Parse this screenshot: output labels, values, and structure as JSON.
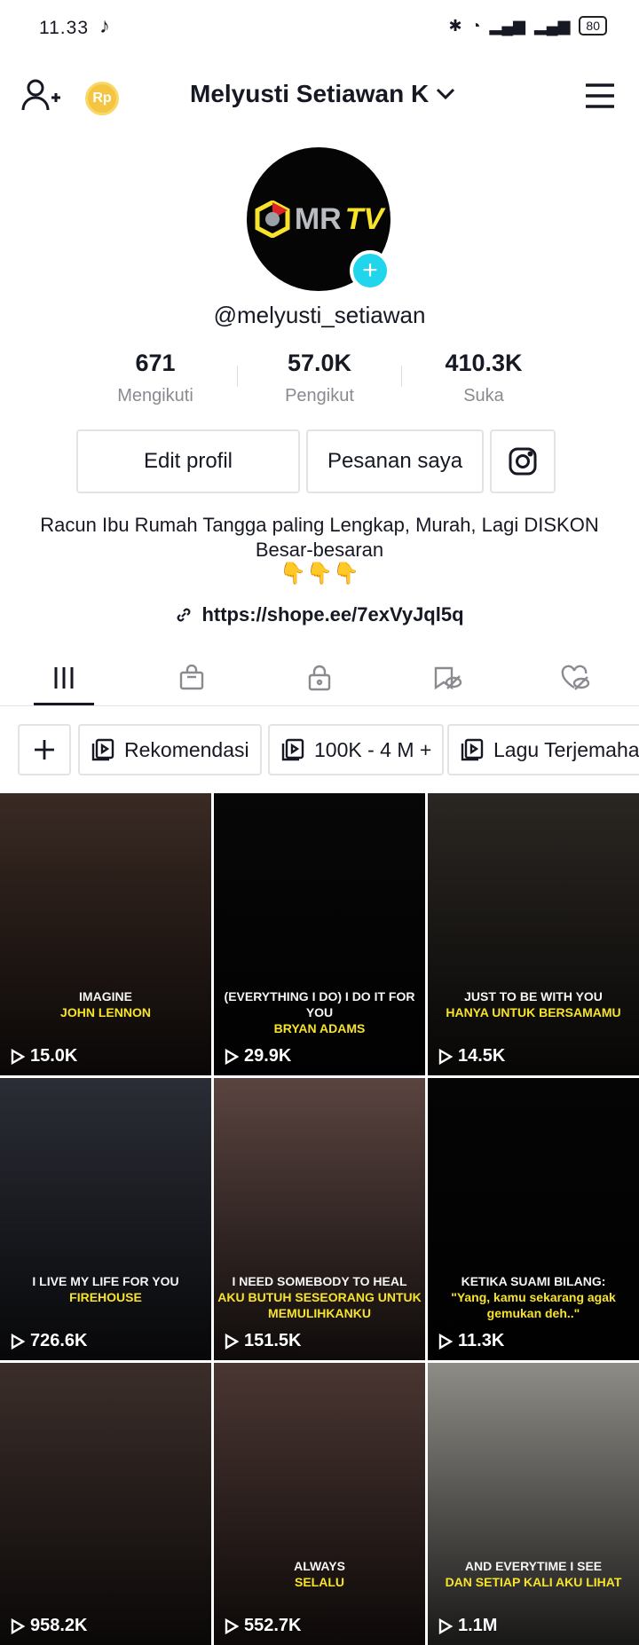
{
  "status_bar": {
    "time": "11.33",
    "battery": "80"
  },
  "header": {
    "username_title": "Melyusti Setiawan K",
    "coin_label": "Rp"
  },
  "profile": {
    "avatar_text_a": "MR",
    "avatar_text_b": "TV",
    "handle": "@melyusti_setiawan",
    "stats": [
      {
        "value": "671",
        "label": "Mengikuti"
      },
      {
        "value": "57.0K",
        "label": "Pengikut"
      },
      {
        "value": "410.3K",
        "label": "Suka"
      }
    ],
    "buttons": {
      "edit": "Edit profil",
      "orders": "Pesanan saya"
    },
    "bio": "Racun Ibu Rumah Tangga paling Lengkap, Murah, Lagi DISKON Besar-besaran",
    "bio_emoji": "👇👇👇",
    "link": "https://shope.ee/7exVyJql5q"
  },
  "playlists": [
    {
      "label": "Rekomendasi"
    },
    {
      "label": "100K - 4 M +"
    },
    {
      "label": "Lagu Terjemahan"
    }
  ],
  "videos": [
    {
      "views": "15.0K",
      "cap1": "IMAGINE",
      "cap2": "JOHN LENNON",
      "bg": "#3a2a24"
    },
    {
      "views": "29.9K",
      "cap1": "(EVERYTHING I DO) I DO IT FOR YOU",
      "cap2": "BRYAN ADAMS",
      "bg": "#070707"
    },
    {
      "views": "14.5K",
      "cap1": "JUST TO BE WITH YOU",
      "cap2": "HANYA UNTUK BERSAMAMU",
      "bg": "#2a2622"
    },
    {
      "views": "726.6K",
      "cap1": "I LIVE MY LIFE FOR YOU",
      "cap2": "FIREHOUSE",
      "bg": "#2b2d36"
    },
    {
      "views": "151.5K",
      "cap1": "I NEED SOMEBODY TO HEAL",
      "cap2": "AKU BUTUH SESEORANG UNTUK MEMULIHKANKU",
      "bg": "#5a4440"
    },
    {
      "views": "11.3K",
      "cap1": "KETIKA SUAMI BILANG:",
      "cap2": "\"Yang, kamu sekarang agak gemukan deh..\"",
      "bg": "#050505"
    },
    {
      "views": "958.2K",
      "cap1": "",
      "cap2": "",
      "bg": "#3b2e2a"
    },
    {
      "views": "552.7K",
      "cap1": "ALWAYS",
      "cap2": "SELALU",
      "bg": "#4a3632"
    },
    {
      "views": "1.1M",
      "cap1": "AND EVERYTIME I SEE",
      "cap2": "DAN SETIAP KALI AKU LIHAT",
      "bg": "#8e8c86"
    }
  ]
}
